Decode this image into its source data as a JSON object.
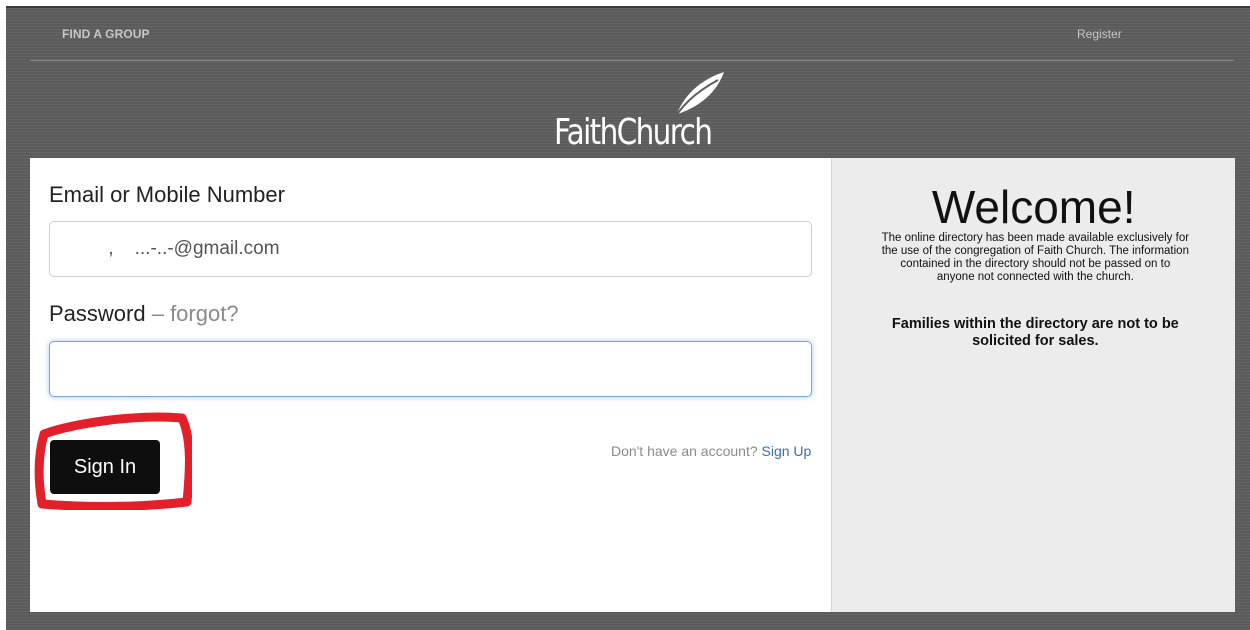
{
  "nav": {
    "find_group": "FIND A GROUP",
    "register": "Register"
  },
  "logo": {
    "text": "FaithChurch",
    "icon": "leaf-icon"
  },
  "form": {
    "email_label": "Email or Mobile Number",
    "email_value": "        ,    ...-..-@gmail.com",
    "password_label": "Password",
    "forgot_separator": " – ",
    "forgot_label": "forgot?",
    "password_value": "",
    "signin_label": "Sign In",
    "no_account_text": "Don't have an account? ",
    "signup_label": "Sign Up"
  },
  "welcome": {
    "title": "Welcome!",
    "body": "The online directory has been made available exclusively for the use of the congregation of Faith Church. The information contained in the directory should not be passed on to anyone not connected with the church.",
    "bold": "Families within the directory are not to be solicited for sales."
  },
  "colors": {
    "background": "#5e5e5e",
    "panel": "#ffffff",
    "sidebar": "#ececec",
    "button": "#0e0e0e",
    "link": "#3b6fa5",
    "highlight": "#e3202a"
  }
}
